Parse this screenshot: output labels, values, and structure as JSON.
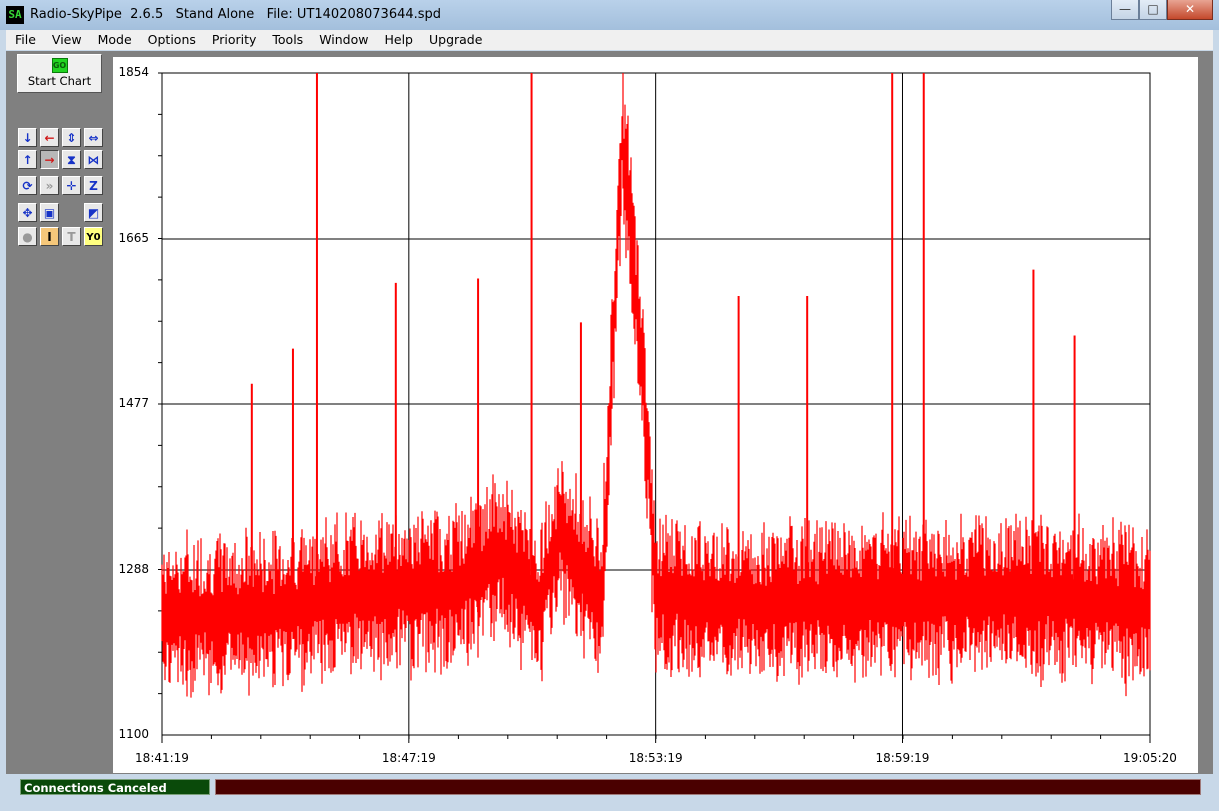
{
  "window": {
    "app_icon": "SA",
    "title": "Radio-SkyPipe  2.6.5   Stand Alone   File: UT140208073644.spd",
    "controls": [
      "minimize",
      "maximize",
      "close"
    ]
  },
  "menu": [
    "File",
    "View",
    "Mode",
    "Options",
    "Priority",
    "Tools",
    "Window",
    "Help",
    "Upgrade"
  ],
  "toolbar": {
    "go_icon": "GO",
    "start_label": "Start Chart",
    "tools": [
      {
        "name": "arrow-down-icon",
        "glyph": "↓"
      },
      {
        "name": "arrow-left-icon",
        "glyph": "←"
      },
      {
        "name": "expand-vertical-icon",
        "glyph": "⇕"
      },
      {
        "name": "expand-horizontal-icon",
        "glyph": "⇔"
      },
      {
        "name": "arrow-up-icon",
        "glyph": "↑"
      },
      {
        "name": "arrow-right-icon",
        "glyph": "→"
      },
      {
        "name": "compress-vertical-icon",
        "glyph": "⧗"
      },
      {
        "name": "compress-horizontal-icon",
        "glyph": "⋈"
      },
      {
        "name": "refresh-icon",
        "glyph": "⟳"
      },
      {
        "name": "fast-forward-icon",
        "glyph": "»"
      },
      {
        "name": "crosshair-icon",
        "glyph": "✛"
      },
      {
        "name": "zoom-box-icon",
        "glyph": "Z"
      },
      {
        "name": "pan-icon",
        "glyph": "✥"
      },
      {
        "name": "zoom-select-icon",
        "glyph": "▣"
      },
      {
        "name": "chart-export-icon",
        "glyph": "◩"
      },
      {
        "name": "record-icon",
        "glyph": "●"
      },
      {
        "name": "insert-text-icon",
        "glyph": "I"
      },
      {
        "name": "text-icon",
        "glyph": "T"
      },
      {
        "name": "y-zero-icon",
        "glyph": "Y0"
      }
    ]
  },
  "status": {
    "connection": "Connections Canceled"
  },
  "chart_data": {
    "type": "line",
    "y_ticks": [
      "1854",
      "1665",
      "1477",
      "1288",
      "1100"
    ],
    "x_ticks": [
      "18:41:19",
      "18:47:19",
      "18:53:19",
      "18:59:19",
      "19:05:20"
    ],
    "ylim": [
      1100,
      1854
    ],
    "xlim": [
      "18:41:19",
      "19:05:20"
    ],
    "grid": true,
    "series": [
      {
        "color": "#ff0000",
        "baseline_profile": [
          {
            "t": "18:41:19",
            "v": 1235
          },
          {
            "t": "18:44:00",
            "v": 1240
          },
          {
            "t": "18:45:30",
            "v": 1255
          },
          {
            "t": "18:47:00",
            "v": 1265
          },
          {
            "t": "18:48:30",
            "v": 1265
          },
          {
            "t": "18:49:30",
            "v": 1305
          },
          {
            "t": "18:50:30",
            "v": 1250
          },
          {
            "t": "18:51:00",
            "v": 1330
          },
          {
            "t": "18:51:30",
            "v": 1290
          },
          {
            "t": "18:52:00",
            "v": 1250
          },
          {
            "t": "18:52:30",
            "v": 1780
          },
          {
            "t": "18:53:00",
            "v": 1520
          },
          {
            "t": "18:53:19",
            "v": 1260
          },
          {
            "t": "18:56:00",
            "v": 1250
          },
          {
            "t": "19:00:00",
            "v": 1255
          },
          {
            "t": "19:02:00",
            "v": 1260
          },
          {
            "t": "19:05:20",
            "v": 1245
          }
        ],
        "spikes": [
          {
            "t": "18:45:05",
            "v": 1854
          },
          {
            "t": "18:50:18",
            "v": 1854
          },
          {
            "t": "18:59:04",
            "v": 1854
          },
          {
            "t": "18:59:50",
            "v": 1854
          },
          {
            "t": "18:47:00",
            "v": 1615
          },
          {
            "t": "18:49:00",
            "v": 1620
          },
          {
            "t": "18:51:30",
            "v": 1570
          },
          {
            "t": "18:55:20",
            "v": 1600
          },
          {
            "t": "18:57:00",
            "v": 1600
          },
          {
            "t": "19:02:30",
            "v": 1630
          },
          {
            "t": "19:03:30",
            "v": 1555
          },
          {
            "t": "18:43:30",
            "v": 1500
          },
          {
            "t": "18:44:30",
            "v": 1540
          }
        ]
      }
    ]
  }
}
